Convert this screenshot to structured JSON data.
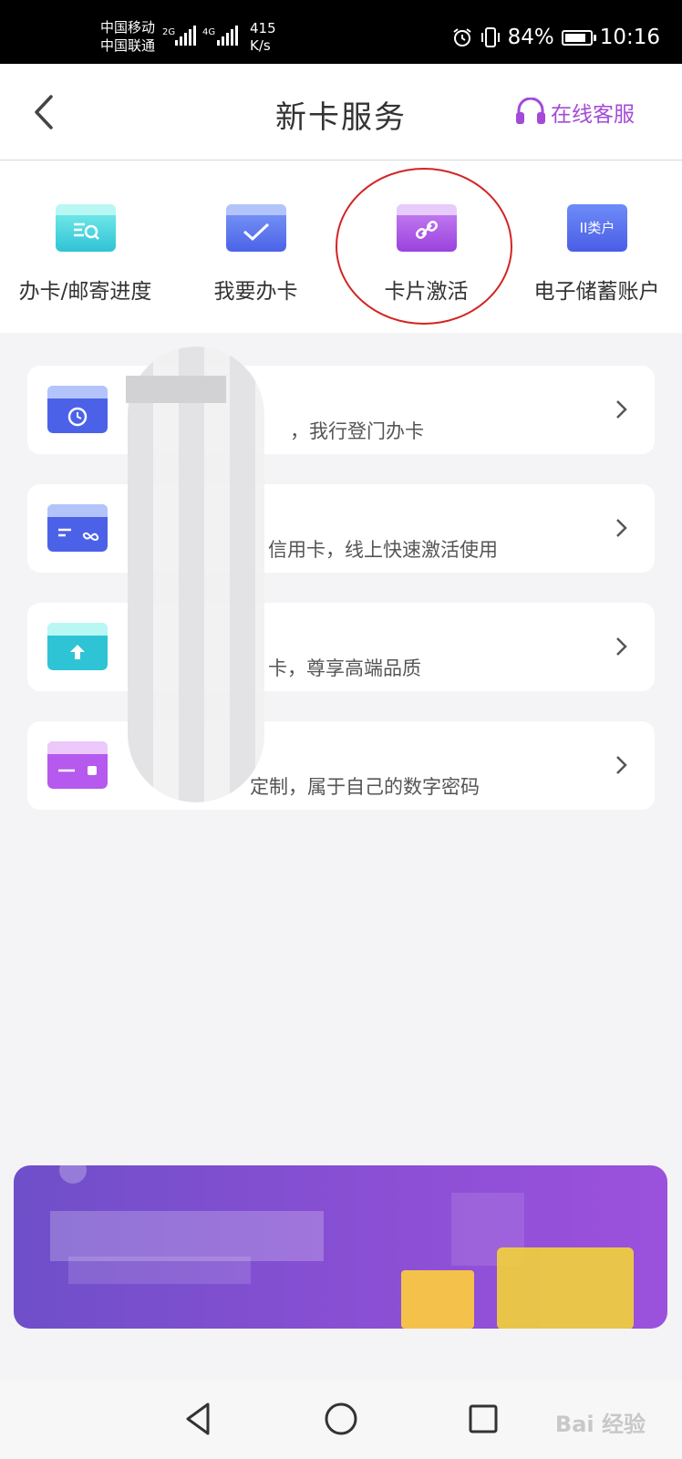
{
  "status_bar": {
    "carrier_1": "中国移动",
    "carrier_2": "中国联通",
    "net_1": "2G",
    "net_2": "4G",
    "speed": "415",
    "speed_unit": "K/s",
    "battery": "84%",
    "battery_level": 0.84,
    "time": "10:16"
  },
  "header": {
    "title": "新卡服务",
    "customer_service": "在线客服",
    "back_icon": "chevron-left-icon",
    "cs_icon": "headset-icon",
    "cs_color": "#a34ad8"
  },
  "services": [
    {
      "label": "办卡/邮寄进度",
      "icon": "card-search-icon",
      "color": "#3fd3d8"
    },
    {
      "label": "我要办卡",
      "icon": "card-check-icon",
      "color": "#4b74ee"
    },
    {
      "label": "卡片激活",
      "icon": "card-link-icon",
      "color": "#a24ee0"
    },
    {
      "label": "电子储蓄账户",
      "icon": "account-class-icon",
      "color": "#4b6cf0",
      "icon_text": "II类户"
    }
  ],
  "list": [
    {
      "title": "",
      "desc": "，我行登门办卡",
      "icon": "card-clock-icon",
      "color": "#4b6cf0"
    },
    {
      "title": "",
      "desc": "信用卡，线上快速激活使用",
      "icon": "card-infinity-icon",
      "color": "#4b6cf0"
    },
    {
      "title": "",
      "desc": "卡，尊享高端品质",
      "icon": "card-upgrade-icon",
      "color": "#3fd3d8"
    },
    {
      "title": "",
      "desc": "定制，属于自己的数字密码",
      "icon": "card-pin-icon",
      "color": "#c75ef0"
    }
  ],
  "watermark": "Bai 经验",
  "nav": {
    "back": "triangle-back-icon",
    "home": "circle-home-icon",
    "recent": "square-recent-icon"
  }
}
